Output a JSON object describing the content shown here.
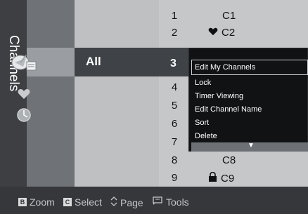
{
  "title": "Channels",
  "category": {
    "selected": "All"
  },
  "channels": [
    {
      "num": "1",
      "name": "C1",
      "icon": ""
    },
    {
      "num": "2",
      "name": "C2",
      "icon": "favorite-heart"
    },
    {
      "num": "3",
      "name": "",
      "icon": ""
    },
    {
      "num": "4",
      "name": "",
      "icon": ""
    },
    {
      "num": "5",
      "name": "",
      "icon": ""
    },
    {
      "num": "6",
      "name": "",
      "icon": ""
    },
    {
      "num": "7",
      "name": "",
      "icon": ""
    },
    {
      "num": "8",
      "name": "C8",
      "icon": ""
    },
    {
      "num": "9",
      "name": "C9",
      "icon": "lock"
    }
  ],
  "popup": {
    "items": [
      "Edit My Channels",
      "Lock",
      "Timer Viewing",
      "Edit Channel Name",
      "Sort",
      "Delete"
    ],
    "focused": "Edit My Channels",
    "more_icon": "down-arrow"
  },
  "hints": {
    "zoom_key": "B",
    "zoom": "Zoom",
    "select_key": "C",
    "select": "Select",
    "page": "Page",
    "tools": "Tools"
  },
  "colors": {
    "popup_bg": "#111214",
    "highlight": "#3f4246",
    "bottom_bar": "#35373a"
  }
}
